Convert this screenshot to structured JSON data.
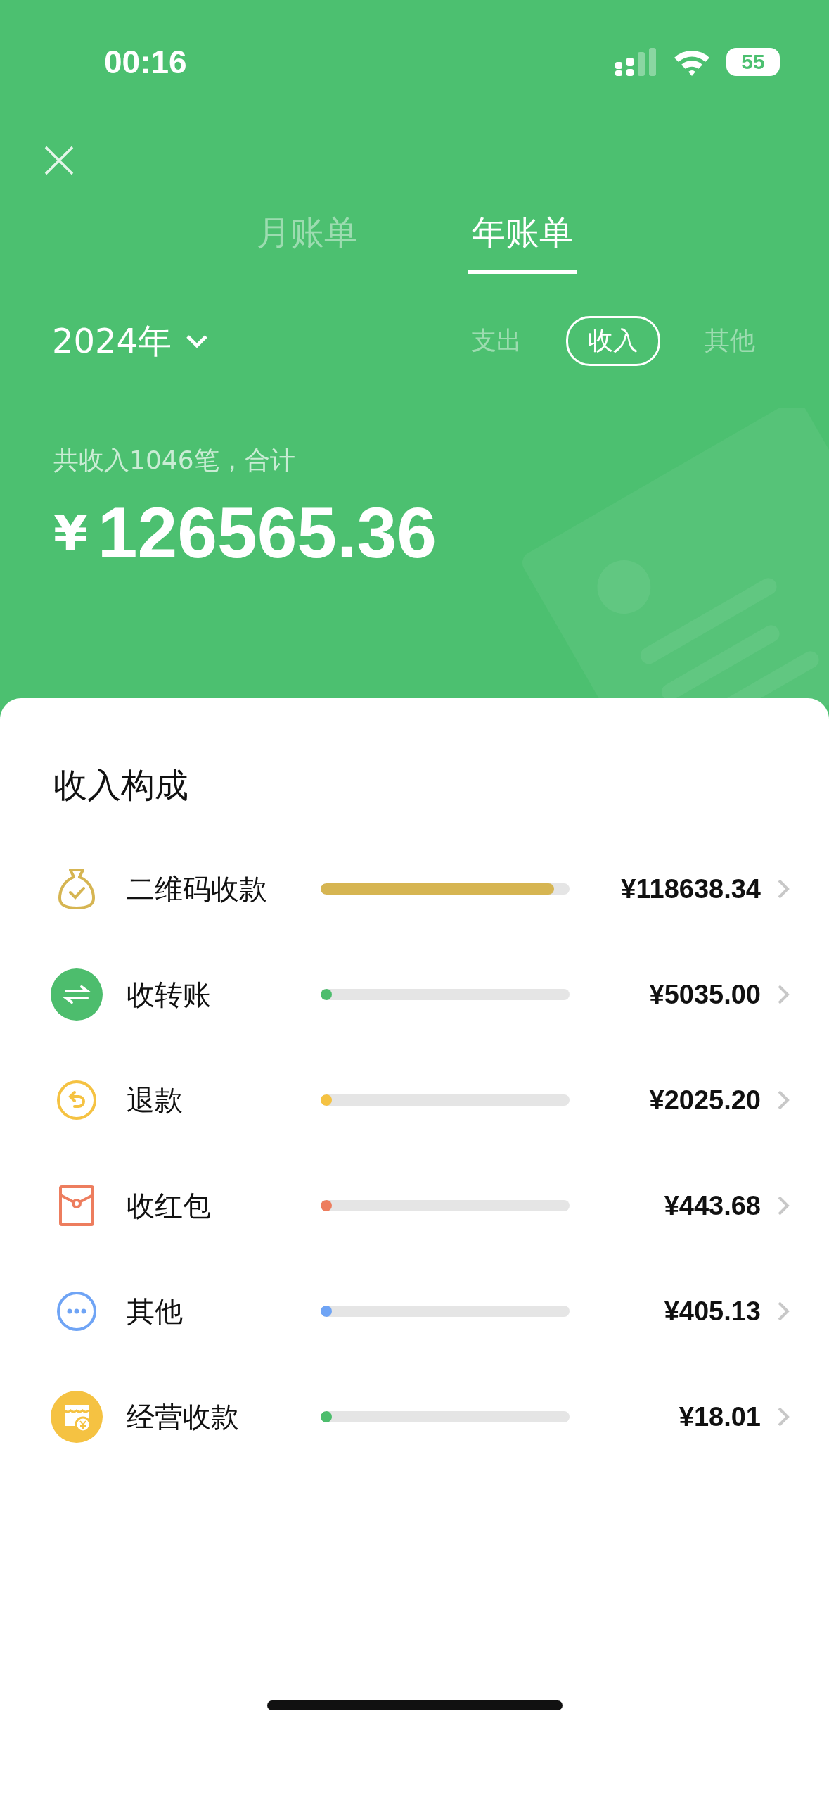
{
  "status_bar": {
    "time": "00:16",
    "battery": "55"
  },
  "tabs": [
    {
      "label": "月账单",
      "selected": false
    },
    {
      "label": "年账单",
      "selected": true
    }
  ],
  "year_picker": {
    "label": "2024年"
  },
  "filters": [
    {
      "label": "支出",
      "selected": false
    },
    {
      "label": "收入",
      "selected": true
    },
    {
      "label": "其他",
      "selected": false
    }
  ],
  "summary": {
    "caption": "共收入1046笔，合计",
    "currency": "¥",
    "amount": "126565.36"
  },
  "breakdown": {
    "title": "收入构成",
    "items": [
      {
        "kind": "bag",
        "label": "二维码收款",
        "level": 0.937,
        "amount": "¥118638.34",
        "color": "#d6b552"
      },
      {
        "kind": "transfer",
        "label": "收转账",
        "level": 0.04,
        "amount": "¥5035.00",
        "color": "#4dbd6d"
      },
      {
        "kind": "refund",
        "label": "退款",
        "level": 0.016,
        "amount": "¥2025.20",
        "color": "#f5c242"
      },
      {
        "kind": "envelope",
        "label": "收红包",
        "level": 0.0035,
        "amount": "¥443.68",
        "color": "#ed7d5e"
      },
      {
        "kind": "more",
        "label": "其他",
        "level": 0.0032,
        "amount": "¥405.13",
        "color": "#6fa4f5"
      },
      {
        "kind": "shop",
        "label": "经营收款",
        "level": 0.0001,
        "amount": "¥18.01",
        "color": "#4dbd6d"
      }
    ]
  }
}
